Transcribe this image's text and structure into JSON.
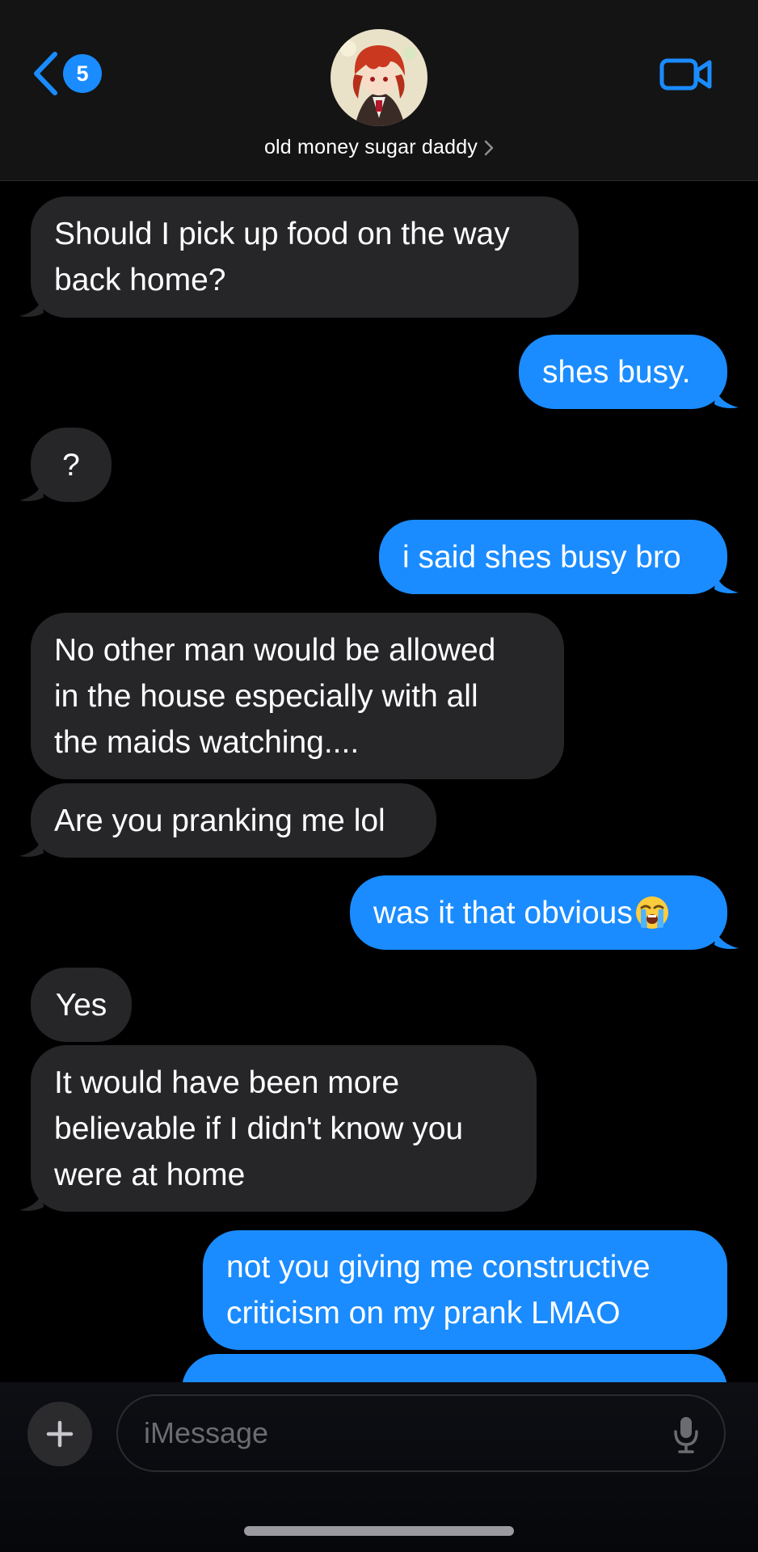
{
  "header": {
    "unread_count": "5",
    "contact_name": "old money sugar daddy",
    "back_icon": "chevron-left-icon",
    "video_icon": "video-camera-icon",
    "accent_color": "#1a8cff"
  },
  "messages": [
    {
      "from": "them",
      "text": "Should I pick up food on the way\nback home?",
      "tail": true
    },
    {
      "from": "me",
      "text": "shes busy.",
      "tail": true
    },
    {
      "from": "them",
      "text": "?",
      "tail": true
    },
    {
      "from": "me",
      "text": "i said shes busy bro",
      "tail": true
    },
    {
      "from": "them",
      "text": "No other man would be allowed\nin the house especially with all\nthe maids watching....",
      "tail": false
    },
    {
      "from": "them",
      "text": "Are you pranking me lol",
      "tail": true
    },
    {
      "from": "me",
      "text": "was it that obvious",
      "emoji": "loudly-crying-face-emoji",
      "tail": true
    },
    {
      "from": "them",
      "text": "Yes",
      "tail": false
    },
    {
      "from": "them",
      "text": "It would have been more\nbelievable if I didn't know you\nwere at home",
      "tail": true
    },
    {
      "from": "me",
      "text": "not you giving me constructive\ncriticism on my prank LMAO",
      "tail": false
    },
    {
      "from": "me",
      "text": "",
      "tail": false,
      "partially_visible": true
    }
  ],
  "composer": {
    "placeholder": "iMessage",
    "value": "",
    "plus_icon": "plus-icon",
    "mic_icon": "microphone-icon"
  },
  "colors": {
    "incoming_bubble": "#262629",
    "outgoing_bubble": "#1a8cff",
    "background": "#000000"
  }
}
